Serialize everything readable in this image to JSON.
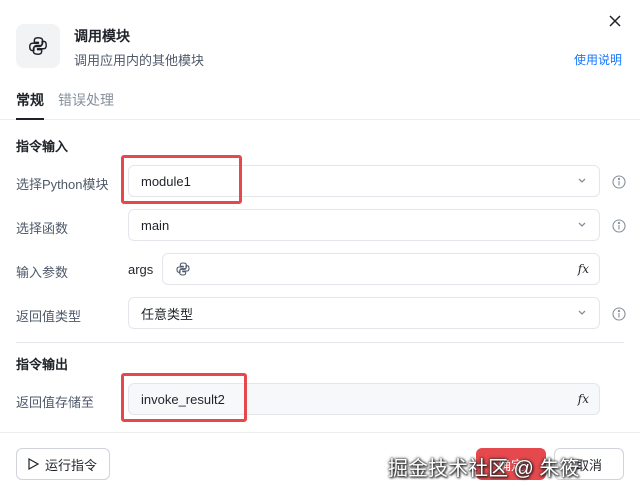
{
  "header": {
    "title": "调用模块",
    "subtitle": "调用应用内的其他模块",
    "help_link": "使用说明",
    "icon": "python-icon",
    "close_icon": "close-icon"
  },
  "tabs": [
    {
      "label": "常规",
      "active": true
    },
    {
      "label": "错误处理",
      "active": false
    }
  ],
  "input_section": {
    "title": "指令输入",
    "rows": [
      {
        "label": "选择Python模块",
        "value": "module1",
        "control": "select"
      },
      {
        "label": "选择函数",
        "value": "main",
        "control": "select"
      },
      {
        "label": "输入参数",
        "prefix": "args",
        "value": "",
        "control": "python-input"
      },
      {
        "label": "返回值类型",
        "value": "任意类型",
        "control": "select"
      }
    ]
  },
  "output_section": {
    "title": "指令输出",
    "rows": [
      {
        "label": "返回值存储至",
        "value": "invoke_result2",
        "control": "variable-input"
      }
    ]
  },
  "footer": {
    "run_label": "运行指令",
    "confirm_label": "确定",
    "cancel_label": "取消"
  },
  "watermark": "掘金技术社区 @ 朱筱",
  "colors": {
    "accent_link": "#1677ff",
    "highlight_box": "#e5484d",
    "text_primary": "#1f2329",
    "text_secondary": "#4e5969",
    "border": "#e5e6eb"
  }
}
